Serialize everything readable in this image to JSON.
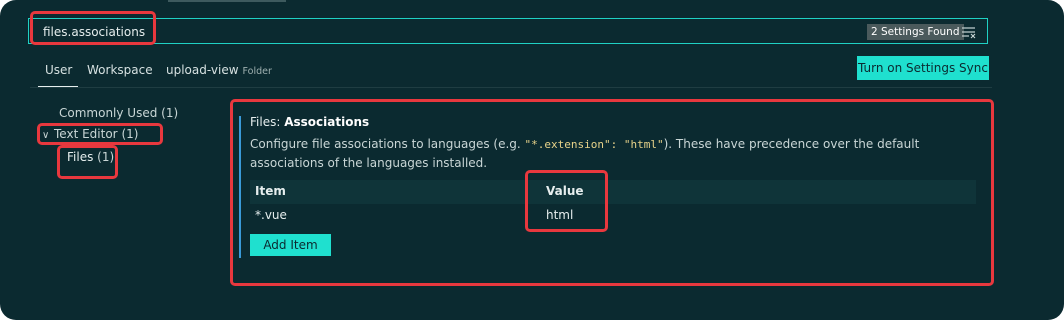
{
  "search": {
    "value": "files.associations",
    "results_badge": "2 Settings Found"
  },
  "tabs": [
    {
      "label": "User"
    },
    {
      "label": "Workspace"
    },
    {
      "label": "upload-view",
      "tag": "Folder"
    }
  ],
  "sync_button": {
    "label": "Turn on Settings Sync"
  },
  "tree": {
    "commonly_used": {
      "label": "Commonly Used",
      "count": "(1)"
    },
    "text_editor": {
      "label": "Text Editor",
      "count": "(1)"
    },
    "files": {
      "label": "Files",
      "count": "(1)"
    }
  },
  "setting": {
    "category": "Files: ",
    "name": "Associations",
    "desc_part1": "Configure file associations to languages (e.g. ",
    "desc_code": "\"*.extension\": \"html\"",
    "desc_part2": "). These have precedence over the default associations of the languages installed.",
    "table": {
      "columns": [
        "Item",
        "Value"
      ],
      "rows": [
        {
          "item": "*.vue",
          "value": "html"
        }
      ]
    },
    "add_item_label": "Add Item"
  },
  "colors": {
    "background": "#0b2a30",
    "accent": "#1fe0cf",
    "highlight": "#e8383e"
  },
  "icons": {
    "clear_filter": "clear-filter-icon",
    "chevron": "chevron-down-icon"
  }
}
